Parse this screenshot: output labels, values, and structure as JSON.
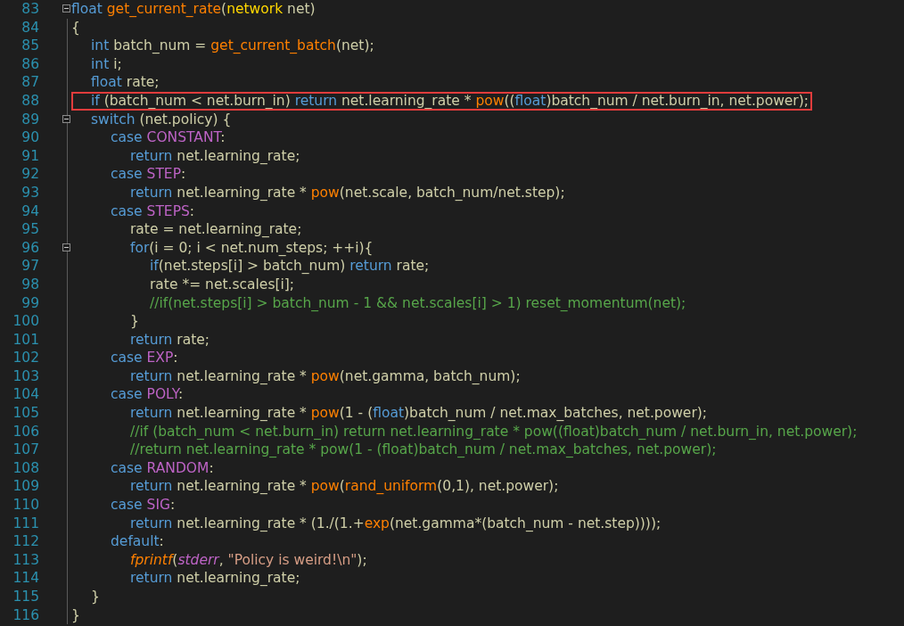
{
  "editor": {
    "lines": [
      {
        "number": "83",
        "fold": true,
        "highlighted": false,
        "tokens": [
          {
            "kind": "k",
            "text": "float "
          },
          {
            "kind": "f",
            "text": "get_current_rate"
          },
          {
            "kind": "p",
            "text": "("
          },
          {
            "kind": "t",
            "text": "network"
          },
          {
            "kind": "p",
            "text": " net)"
          }
        ]
      },
      {
        "number": "84",
        "fold": false,
        "highlighted": false,
        "tokens": [
          {
            "kind": "p",
            "text": "{"
          }
        ],
        "children": [
          {
            "number": "85",
            "fold": false,
            "highlighted": false,
            "tokens": [
              {
                "kind": "k",
                "text": "int"
              },
              {
                "kind": "p",
                "text": " batch_num = "
              },
              {
                "kind": "f",
                "text": "get_current_batch"
              },
              {
                "kind": "p",
                "text": "(net);"
              }
            ]
          },
          {
            "number": "86",
            "fold": false,
            "highlighted": false,
            "tokens": [
              {
                "kind": "k",
                "text": "int"
              },
              {
                "kind": "p",
                "text": " i;"
              }
            ]
          },
          {
            "number": "87",
            "fold": false,
            "highlighted": false,
            "tokens": [
              {
                "kind": "k",
                "text": "float"
              },
              {
                "kind": "p",
                "text": " rate;"
              }
            ]
          },
          {
            "number": "88",
            "fold": false,
            "highlighted": true,
            "tokens": [
              {
                "kind": "k",
                "text": "if"
              },
              {
                "kind": "p",
                "text": " (batch_num < net.burn_in) "
              },
              {
                "kind": "k",
                "text": "return"
              },
              {
                "kind": "p",
                "text": " net.learning_rate * "
              },
              {
                "kind": "f",
                "text": "pow"
              },
              {
                "kind": "p",
                "text": "(("
              },
              {
                "kind": "k",
                "text": "float"
              },
              {
                "kind": "p",
                "text": ")batch_num / net.burn_in, net.power);"
              }
            ]
          },
          {
            "number": "89",
            "fold": true,
            "highlighted": false,
            "tokens": [
              {
                "kind": "k",
                "text": "switch"
              },
              {
                "kind": "p",
                "text": " (net.policy) {"
              }
            ],
            "children": [
              {
                "number": "90",
                "fold": false,
                "highlighted": false,
                "tokens": [
                  {
                    "kind": "k",
                    "text": "case "
                  },
                  {
                    "kind": "m",
                    "text": "CONSTANT"
                  },
                  {
                    "kind": "p",
                    "text": ":"
                  }
                ],
                "children": [
                  {
                    "number": "91",
                    "fold": false,
                    "highlighted": false,
                    "tokens": [
                      {
                        "kind": "k",
                        "text": "return"
                      },
                      {
                        "kind": "p",
                        "text": " net.learning_rate;"
                      }
                    ]
                  }
                ]
              },
              {
                "number": "92",
                "fold": false,
                "highlighted": false,
                "tokens": [
                  {
                    "kind": "k",
                    "text": "case "
                  },
                  {
                    "kind": "m",
                    "text": "STEP"
                  },
                  {
                    "kind": "p",
                    "text": ":"
                  }
                ],
                "children": [
                  {
                    "number": "93",
                    "fold": false,
                    "highlighted": false,
                    "tokens": [
                      {
                        "kind": "k",
                        "text": "return"
                      },
                      {
                        "kind": "p",
                        "text": " net.learning_rate * "
                      },
                      {
                        "kind": "f",
                        "text": "pow"
                      },
                      {
                        "kind": "p",
                        "text": "(net.scale, batch_num/net.step);"
                      }
                    ]
                  }
                ]
              },
              {
                "number": "94",
                "fold": false,
                "highlighted": false,
                "tokens": [
                  {
                    "kind": "k",
                    "text": "case "
                  },
                  {
                    "kind": "m",
                    "text": "STEPS"
                  },
                  {
                    "kind": "p",
                    "text": ":"
                  }
                ],
                "children": [
                  {
                    "number": "95",
                    "fold": false,
                    "highlighted": false,
                    "tokens": [
                      {
                        "kind": "p",
                        "text": "rate = net.learning_rate;"
                      }
                    ]
                  },
                  {
                    "number": "96",
                    "fold": true,
                    "highlighted": false,
                    "tokens": [
                      {
                        "kind": "k",
                        "text": "for"
                      },
                      {
                        "kind": "p",
                        "text": "(i = 0; i < net.num_steps; ++i){"
                      }
                    ],
                    "children": [
                      {
                        "number": "97",
                        "fold": false,
                        "highlighted": false,
                        "tokens": [
                          {
                            "kind": "k",
                            "text": "if"
                          },
                          {
                            "kind": "p",
                            "text": "(net.steps[i] > batch_num) "
                          },
                          {
                            "kind": "k",
                            "text": "return"
                          },
                          {
                            "kind": "p",
                            "text": " rate;"
                          }
                        ]
                      },
                      {
                        "number": "98",
                        "fold": false,
                        "highlighted": false,
                        "tokens": [
                          {
                            "kind": "p",
                            "text": "rate *= net.scales[i];"
                          }
                        ]
                      },
                      {
                        "number": "99",
                        "fold": false,
                        "highlighted": false,
                        "tokens": [
                          {
                            "kind": "c",
                            "text": "//if(net.steps[i] > batch_num - 1 && net.scales[i] > 1) reset_momentum(net);"
                          }
                        ]
                      }
                    ]
                  },
                  {
                    "number": "100",
                    "fold": false,
                    "highlighted": false,
                    "tokens": [
                      {
                        "kind": "p",
                        "text": "}"
                      }
                    ]
                  },
                  {
                    "number": "101",
                    "fold": false,
                    "highlighted": false,
                    "tokens": [
                      {
                        "kind": "k",
                        "text": "return"
                      },
                      {
                        "kind": "p",
                        "text": " rate;"
                      }
                    ]
                  }
                ]
              },
              {
                "number": "102",
                "fold": false,
                "highlighted": false,
                "tokens": [
                  {
                    "kind": "k",
                    "text": "case "
                  },
                  {
                    "kind": "m",
                    "text": "EXP"
                  },
                  {
                    "kind": "p",
                    "text": ":"
                  }
                ],
                "children": [
                  {
                    "number": "103",
                    "fold": false,
                    "highlighted": false,
                    "tokens": [
                      {
                        "kind": "k",
                        "text": "return"
                      },
                      {
                        "kind": "p",
                        "text": " net.learning_rate * "
                      },
                      {
                        "kind": "f",
                        "text": "pow"
                      },
                      {
                        "kind": "p",
                        "text": "(net.gamma, batch_num);"
                      }
                    ]
                  }
                ]
              },
              {
                "number": "104",
                "fold": false,
                "highlighted": false,
                "tokens": [
                  {
                    "kind": "k",
                    "text": "case "
                  },
                  {
                    "kind": "m",
                    "text": "POLY"
                  },
                  {
                    "kind": "p",
                    "text": ":"
                  }
                ],
                "children": [
                  {
                    "number": "105",
                    "fold": false,
                    "highlighted": false,
                    "tokens": [
                      {
                        "kind": "k",
                        "text": "return"
                      },
                      {
                        "kind": "p",
                        "text": " net.learning_rate * "
                      },
                      {
                        "kind": "f",
                        "text": "pow"
                      },
                      {
                        "kind": "p",
                        "text": "(1 - ("
                      },
                      {
                        "kind": "k",
                        "text": "float"
                      },
                      {
                        "kind": "p",
                        "text": ")batch_num / net.max_batches, net.power);"
                      }
                    ]
                  },
                  {
                    "number": "106",
                    "fold": false,
                    "highlighted": false,
                    "tokens": [
                      {
                        "kind": "c",
                        "text": "//if (batch_num < net.burn_in) return net.learning_rate * pow((float)batch_num / net.burn_in, net.power);"
                      }
                    ]
                  },
                  {
                    "number": "107",
                    "fold": false,
                    "highlighted": false,
                    "tokens": [
                      {
                        "kind": "c",
                        "text": "//return net.learning_rate * pow(1 - (float)batch_num / net.max_batches, net.power);"
                      }
                    ]
                  }
                ]
              },
              {
                "number": "108",
                "fold": false,
                "highlighted": false,
                "tokens": [
                  {
                    "kind": "k",
                    "text": "case "
                  },
                  {
                    "kind": "m",
                    "text": "RANDOM"
                  },
                  {
                    "kind": "p",
                    "text": ":"
                  }
                ],
                "children": [
                  {
                    "number": "109",
                    "fold": false,
                    "highlighted": false,
                    "tokens": [
                      {
                        "kind": "k",
                        "text": "return"
                      },
                      {
                        "kind": "p",
                        "text": " net.learning_rate * "
                      },
                      {
                        "kind": "f",
                        "text": "pow"
                      },
                      {
                        "kind": "p",
                        "text": "("
                      },
                      {
                        "kind": "f",
                        "text": "rand_uniform"
                      },
                      {
                        "kind": "p",
                        "text": "(0,1), net.power);"
                      }
                    ]
                  }
                ]
              },
              {
                "number": "110",
                "fold": false,
                "highlighted": false,
                "tokens": [
                  {
                    "kind": "k",
                    "text": "case "
                  },
                  {
                    "kind": "m",
                    "text": "SIG"
                  },
                  {
                    "kind": "p",
                    "text": ":"
                  }
                ],
                "children": [
                  {
                    "number": "111",
                    "fold": false,
                    "highlighted": false,
                    "tokens": [
                      {
                        "kind": "k",
                        "text": "return"
                      },
                      {
                        "kind": "p",
                        "text": " net.learning_rate * (1./(1.+"
                      },
                      {
                        "kind": "f",
                        "text": "exp"
                      },
                      {
                        "kind": "p",
                        "text": "(net.gamma*(batch_num - net.step))));"
                      }
                    ]
                  }
                ]
              },
              {
                "number": "112",
                "fold": false,
                "highlighted": false,
                "tokens": [
                  {
                    "kind": "k",
                    "text": "default"
                  },
                  {
                    "kind": "p",
                    "text": ":"
                  }
                ],
                "children": [
                  {
                    "number": "113",
                    "fold": false,
                    "highlighted": false,
                    "tokens": [
                      {
                        "kind": "fi",
                        "text": "fprintf"
                      },
                      {
                        "kind": "p",
                        "text": "("
                      },
                      {
                        "kind": "vi",
                        "text": "stderr"
                      },
                      {
                        "kind": "p",
                        "text": ", "
                      },
                      {
                        "kind": "s",
                        "text": "\"Policy is weird!\\n\""
                      },
                      {
                        "kind": "p",
                        "text": ");"
                      }
                    ]
                  },
                  {
                    "number": "114",
                    "fold": false,
                    "highlighted": false,
                    "tokens": [
                      {
                        "kind": "k",
                        "text": "return"
                      },
                      {
                        "kind": "p",
                        "text": " net.learning_rate;"
                      }
                    ]
                  }
                ]
              }
            ]
          },
          {
            "number": "115",
            "fold": false,
            "highlighted": false,
            "tokens": [
              {
                "kind": "p",
                "text": "}"
              }
            ]
          }
        ]
      },
      {
        "number": "116",
        "fold": false,
        "highlighted": false,
        "tokens": [
          {
            "kind": "p",
            "text": "}"
          }
        ]
      }
    ]
  }
}
